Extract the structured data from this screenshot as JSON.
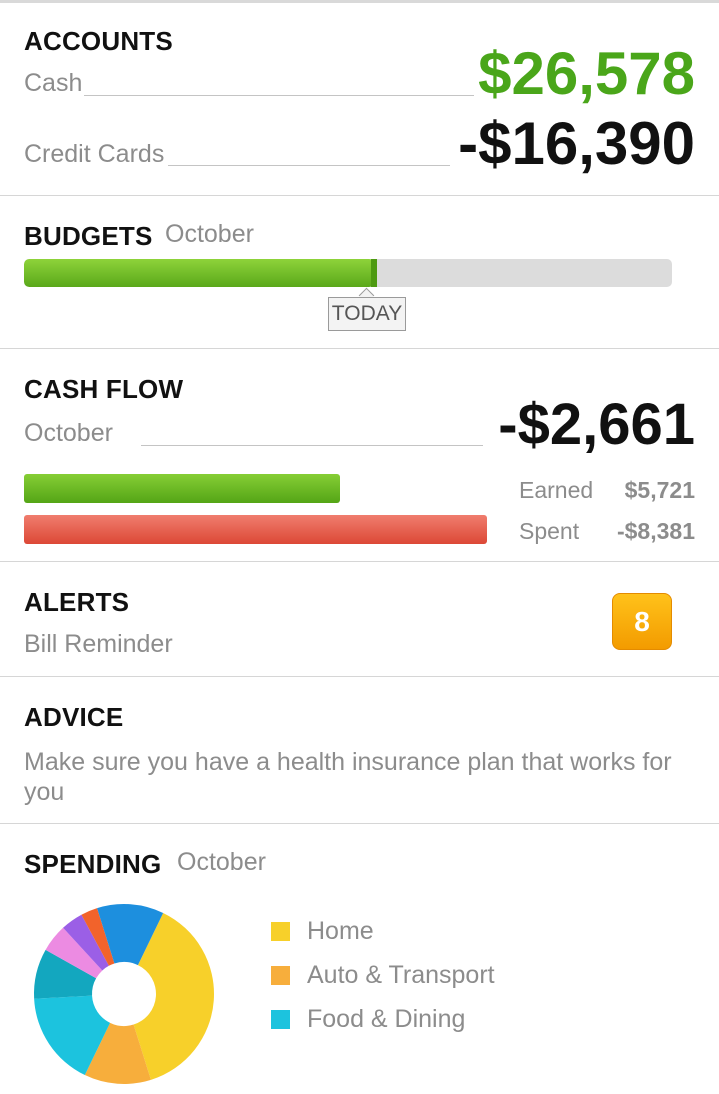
{
  "accounts": {
    "title": "ACCOUNTS",
    "cash_label": "Cash",
    "cash_amount": "$26,578",
    "credit_label": "Credit Cards",
    "credit_amount": "-$16,390",
    "positive_color": "#4aa61a"
  },
  "budgets": {
    "title": "BUDGETS",
    "month": "October",
    "progress_fraction": 0.54,
    "today_fraction": 0.535,
    "today_label": "TODAY"
  },
  "cash_flow": {
    "title": "CASH FLOW",
    "month": "October",
    "net_amount": "-$2,661",
    "earned_label": "Earned",
    "earned_amount": "$5,721",
    "spent_label": "Spent",
    "spent_amount": "-$8,381",
    "earned_value": 5721,
    "spent_value": 8381
  },
  "alerts": {
    "title": "ALERTS",
    "subtitle": "Bill Reminder",
    "count": "8"
  },
  "advice": {
    "title": "ADVICE",
    "text": "Make sure you have a health insurance plan that works for you"
  },
  "spending": {
    "title": "SPENDING",
    "month": "October",
    "legend": [
      {
        "label": "Home",
        "color": "#f7d02a"
      },
      {
        "label": "Auto & Transport",
        "color": "#f7ae3c"
      },
      {
        "label": "Food & Dining",
        "color": "#1cc3de"
      }
    ],
    "chart_data": {
      "type": "pie",
      "style": "donut",
      "slices": [
        {
          "category": "Home",
          "value": 38,
          "color": "#f7d02a"
        },
        {
          "category": "Auto & Transport",
          "value": 12,
          "color": "#f7ae3c"
        },
        {
          "category": "Food & Dining",
          "value": 17,
          "color": "#1cc3de"
        },
        {
          "category": "",
          "value": 9,
          "color": "#13a7bf"
        },
        {
          "category": "",
          "value": 5,
          "color": "#ec8be2"
        },
        {
          "category": "",
          "value": 4,
          "color": "#9b5fe6"
        },
        {
          "category": "",
          "value": 3,
          "color": "#f2632b"
        },
        {
          "category": "",
          "value": 12,
          "color": "#1d8fde"
        }
      ]
    }
  }
}
